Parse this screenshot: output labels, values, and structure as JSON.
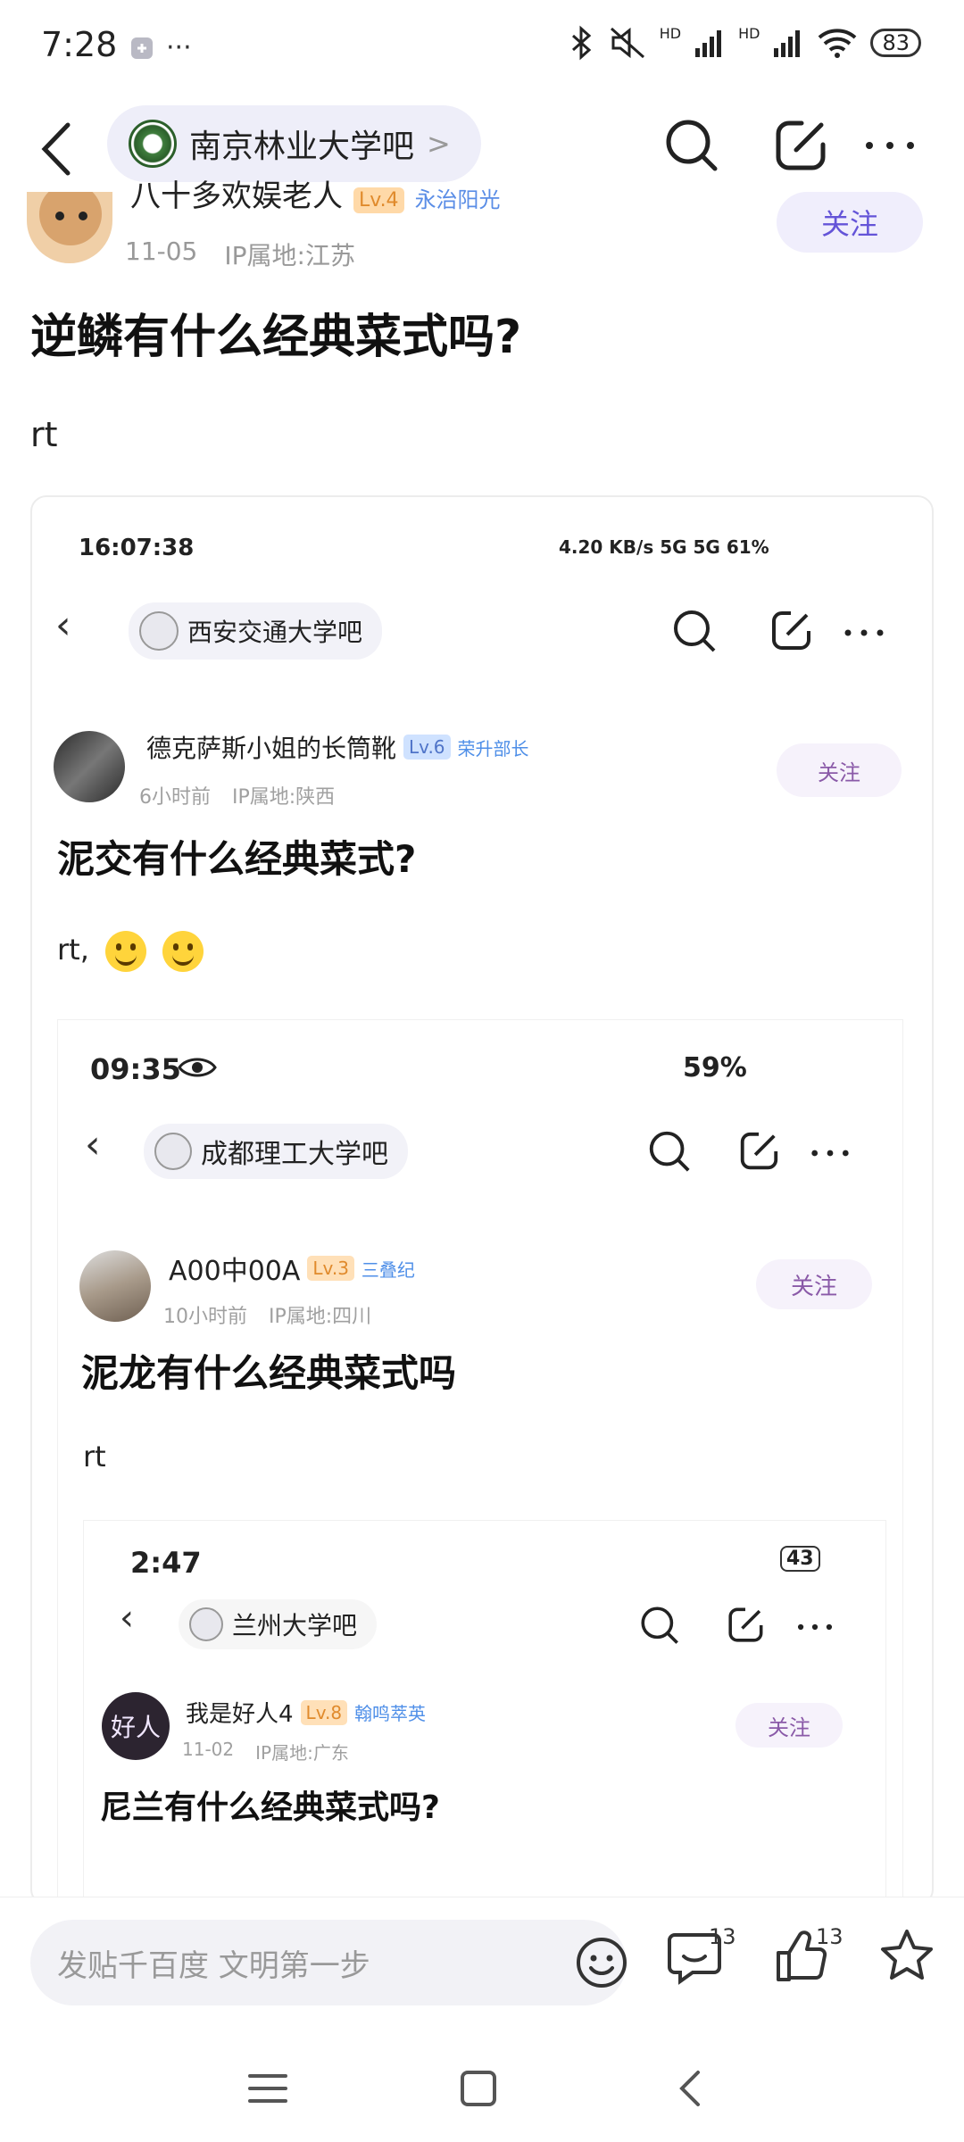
{
  "status_bar": {
    "time": "7:28",
    "dots": "···",
    "net_label_1": "HD",
    "net_label_2": "HD",
    "battery": "83"
  },
  "nav": {
    "forum_name": "南京林业大学吧",
    "arrow": ">"
  },
  "post": {
    "author": "八十多欢娱老人",
    "level": "Lv.4",
    "honor": "永治阳光",
    "date": "11-05",
    "ip": "IP属地:江苏",
    "follow": "关注",
    "title": "逆鳞有什么经典菜式吗?",
    "body": "rt"
  },
  "shot1": {
    "time": "16:07:38",
    "status_right": "4.20 KB/s  5G  5G  61%",
    "forum_name": "西安交通大学吧",
    "author": "德克萨斯小姐的长筒靴",
    "level": "Lv.6",
    "honor": "荣升部长",
    "date": "6小时前",
    "ip": "IP属地:陕西",
    "follow": "关注",
    "title": "泥交有什么经典菜式?",
    "body": "rt,"
  },
  "shot2": {
    "time": "09:35",
    "battery": "59%",
    "forum_name": "成都理工大学吧",
    "author": "A00中00A",
    "level": "Lv.3",
    "honor": "三叠纪",
    "date": "10小时前",
    "ip": "IP属地:四川",
    "follow": "关注",
    "title": "泥龙有什么经典菜式吗",
    "body": "rt"
  },
  "shot3": {
    "time": "2:47",
    "battery": "43",
    "forum_name": "兰州大学吧",
    "author": "我是好人4",
    "level": "Lv.8",
    "honor": "翰鸣萃英",
    "avatar_text": "好人",
    "date": "11-02",
    "ip": "IP属地:广东",
    "follow": "关注",
    "title": "尼兰有什么经典菜式吗?"
  },
  "bottom": {
    "placeholder": "发贴千百度 文明第一步",
    "comment_count": "13",
    "like_count": "13"
  },
  "colors": {
    "accent": "#6454d8",
    "pill_bg": "#eeeef9"
  }
}
